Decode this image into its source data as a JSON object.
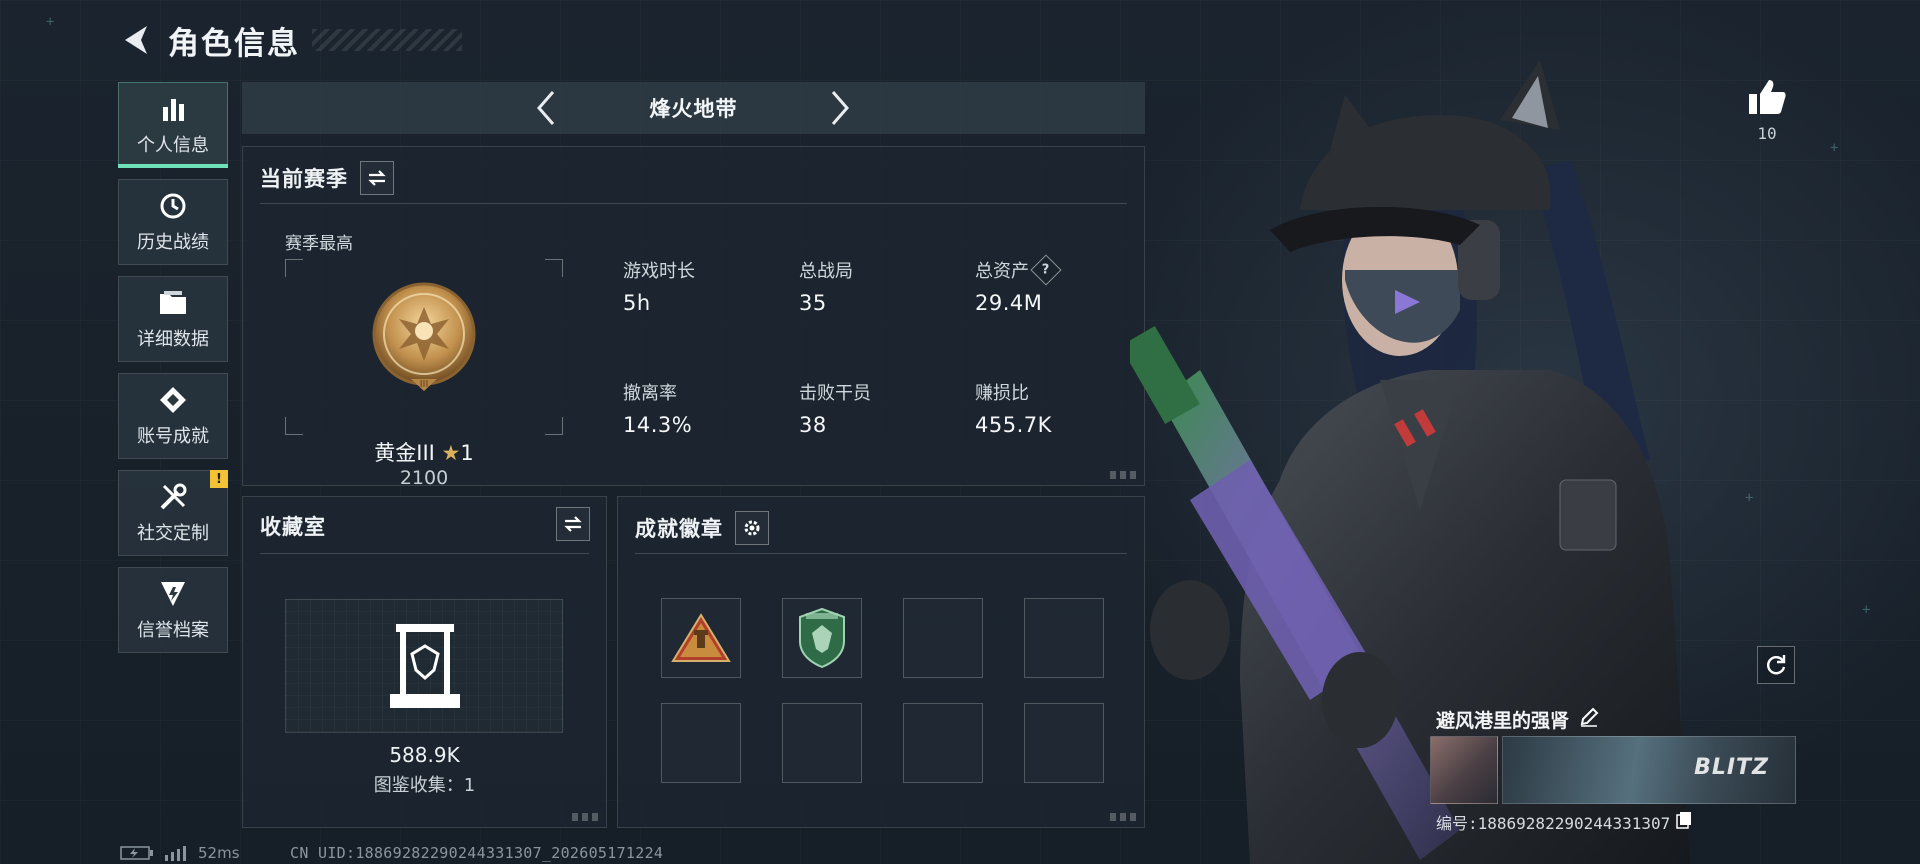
{
  "header": {
    "title": "角色信息"
  },
  "sidenav": {
    "items": [
      {
        "label": "个人信息",
        "icon": "bar-chart-icon",
        "active": true
      },
      {
        "label": "历史战绩",
        "icon": "history-icon"
      },
      {
        "label": "详细数据",
        "icon": "folder-icon"
      },
      {
        "label": "账号成就",
        "icon": "achievement-icon"
      },
      {
        "label": "社交定制",
        "icon": "tools-icon",
        "badge": "!"
      },
      {
        "label": "信誉档案",
        "icon": "reputation-icon"
      }
    ]
  },
  "mode": {
    "title": "烽火地带"
  },
  "season": {
    "title": "当前赛季",
    "subtitle": "赛季最高",
    "rank_name": "黄金III",
    "rank_stars": "1",
    "rank_score": "2100",
    "stats": [
      {
        "label": "游戏时长",
        "value": "5h"
      },
      {
        "label": "总战局",
        "value": "35"
      },
      {
        "label": "总资产",
        "value": "29.4M",
        "help": "?"
      },
      {
        "label": "撤离率",
        "value": "14.3%"
      },
      {
        "label": "击败干员",
        "value": "38"
      },
      {
        "label": "赚损比",
        "value": "455.7K"
      }
    ]
  },
  "collection": {
    "title": "收藏室",
    "value": "588.9K",
    "sub": "图鉴收集：1"
  },
  "badges": {
    "title": "成就徽章",
    "slots": [
      "warning-triangle-badge",
      "green-shield-badge",
      "",
      "",
      "",
      "",
      "",
      ""
    ]
  },
  "player": {
    "likes": "10",
    "name": "避风港里的强肾",
    "banner_text": "BLITZ",
    "id_line": "编号:1886928229024433130​7"
  },
  "footer": {
    "ping": "52ms",
    "uid": "CN UID:1886928229024433130​7_202605171224"
  },
  "colors": {
    "accent": "#6fe0b7",
    "badge_warn": "#f2c335"
  }
}
